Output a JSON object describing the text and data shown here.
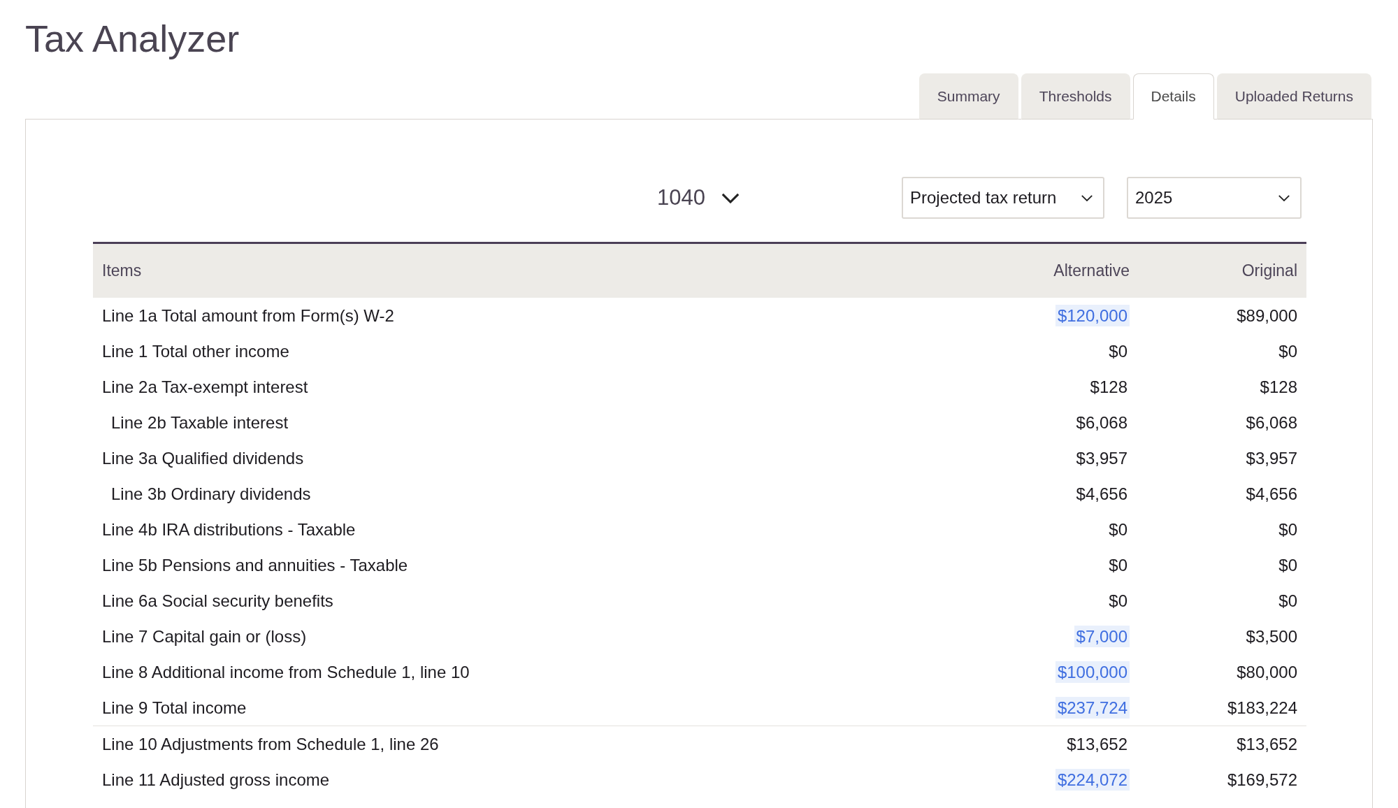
{
  "title": "Tax Analyzer",
  "tabs": [
    {
      "label": "Summary",
      "selected": false
    },
    {
      "label": "Thresholds",
      "selected": false
    },
    {
      "label": "Details",
      "selected": true
    },
    {
      "label": "Uploaded Returns",
      "selected": false
    }
  ],
  "form_selector": {
    "value": "1040"
  },
  "return_type": {
    "value": "Projected tax return"
  },
  "year": {
    "value": "2025"
  },
  "table": {
    "columns": [
      "Items",
      "Alternative",
      "Original"
    ],
    "rows": [
      {
        "item": "Line 1a Total amount from Form(s) W-2",
        "alternative": "$120,000",
        "changed": true,
        "original": "$89,000"
      },
      {
        "item": "Line 1 Total other income",
        "alternative": "$0",
        "changed": false,
        "original": "$0"
      },
      {
        "item": "Line 2a Tax-exempt interest",
        "alternative": "$128",
        "changed": false,
        "original": "$128",
        "children": [
          {
            "item": "Line 2b Taxable interest",
            "alternative": "$6,068",
            "changed": false,
            "original": "$6,068"
          }
        ]
      },
      {
        "item": "Line 3a Qualified dividends",
        "alternative": "$3,957",
        "changed": false,
        "original": "$3,957",
        "children": [
          {
            "item": "Line 3b Ordinary dividends",
            "alternative": "$4,656",
            "changed": false,
            "original": "$4,656"
          }
        ]
      },
      {
        "item": "Line 4b IRA distributions - Taxable",
        "alternative": "$0",
        "changed": false,
        "original": "$0"
      },
      {
        "item": "Line 5b Pensions and annuities - Taxable",
        "alternative": "$0",
        "changed": false,
        "original": "$0"
      },
      {
        "item": "Line 6a Social security benefits",
        "alternative": "$0",
        "changed": false,
        "original": "$0"
      },
      {
        "item": "Line 7 Capital gain or (loss)",
        "alternative": "$7,000",
        "changed": true,
        "original": "$3,500"
      },
      {
        "item": "Line 8 Additional income from Schedule 1, line 10",
        "alternative": "$100,000",
        "changed": true,
        "original": "$80,000"
      },
      {
        "item": "Line 9 Total income",
        "alternative": "$237,724",
        "changed": true,
        "original": "$183,224",
        "divider_after": true
      },
      {
        "item": "Line 10 Adjustments from Schedule 1, line 26",
        "alternative": "$13,652",
        "changed": false,
        "original": "$13,652"
      },
      {
        "item": "Line 11 Adjusted gross income",
        "alternative": "$224,072",
        "changed": true,
        "original": "$169,572"
      }
    ]
  }
}
